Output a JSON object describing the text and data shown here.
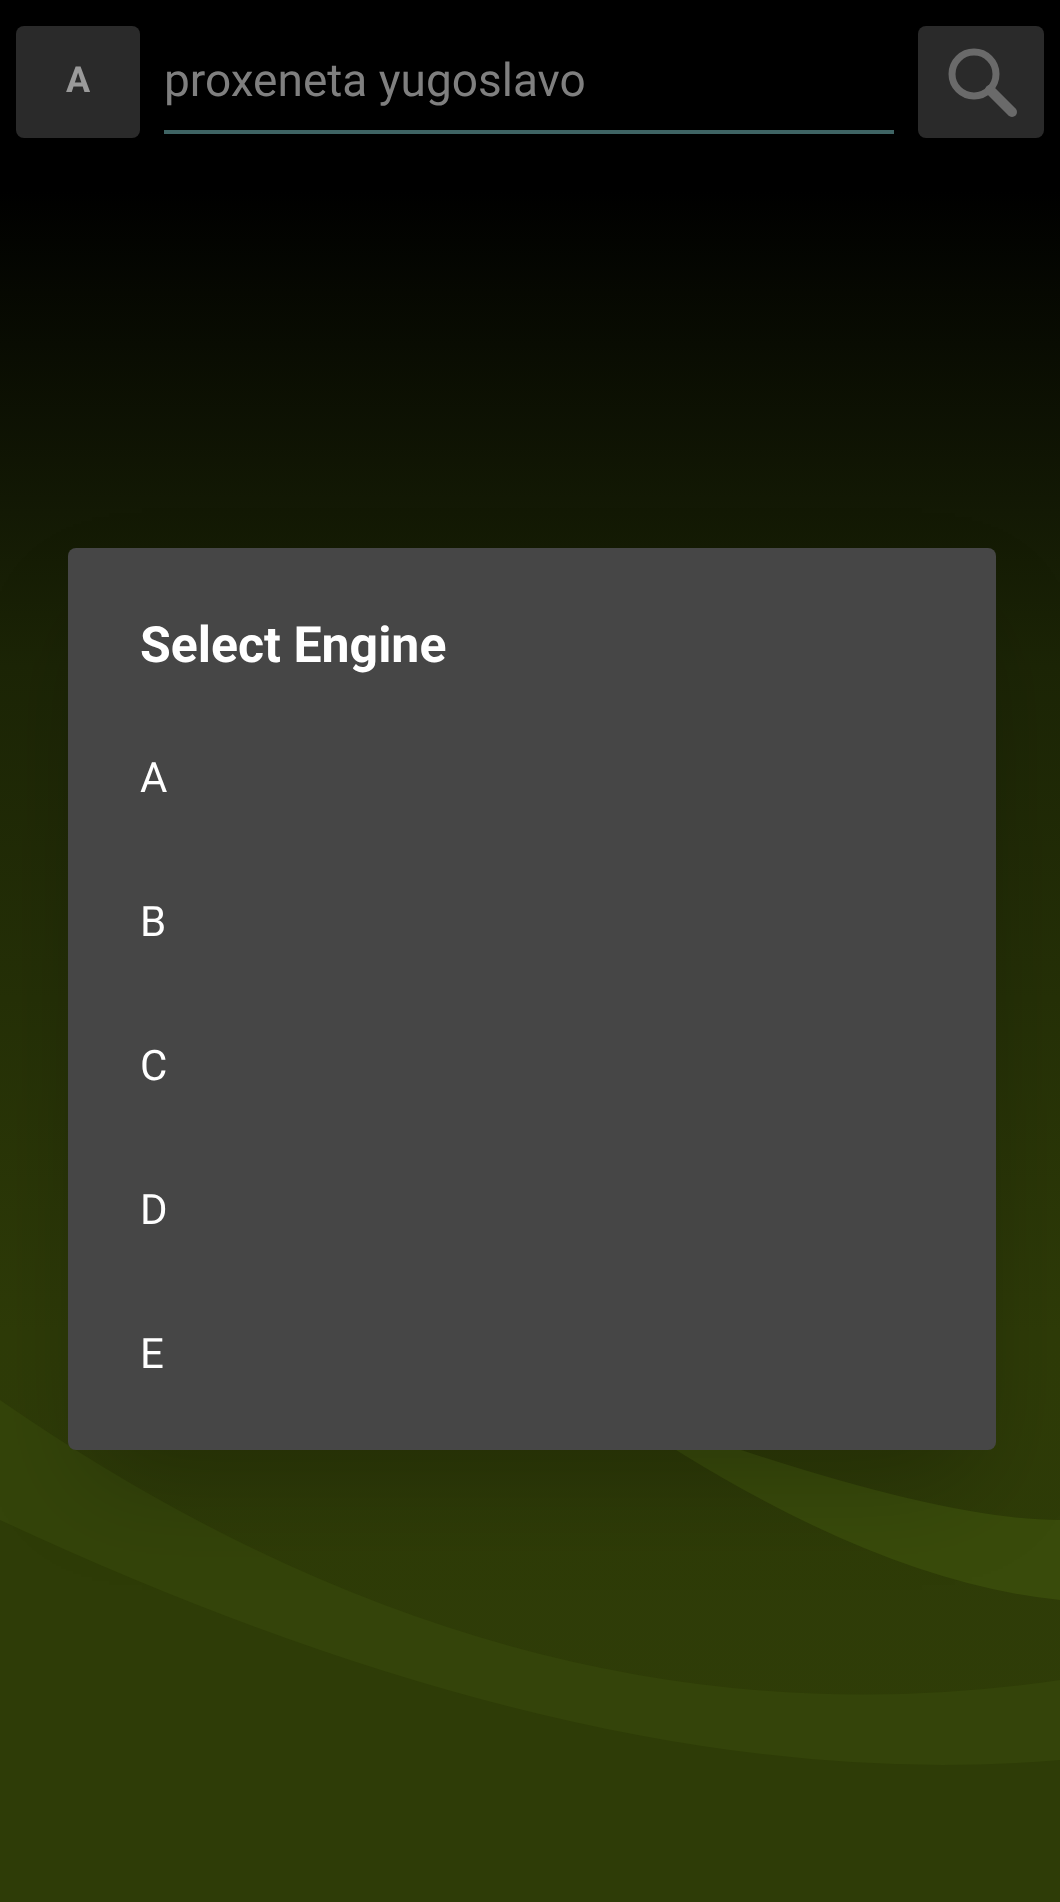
{
  "toolbar": {
    "engine_button": "A",
    "search_field": {
      "value": "proxeneta yugoslavo"
    }
  },
  "dialog": {
    "title": "Select Engine",
    "items": [
      {
        "label": "A"
      },
      {
        "label": "B"
      },
      {
        "label": "C"
      },
      {
        "label": "D"
      },
      {
        "label": "E"
      }
    ]
  }
}
